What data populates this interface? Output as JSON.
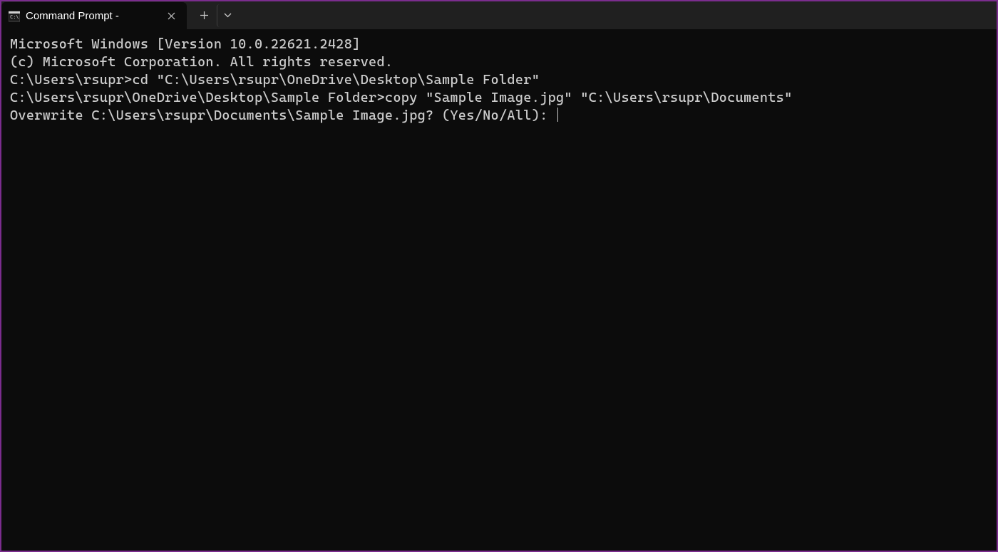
{
  "tab": {
    "title": "Command Prompt -"
  },
  "terminal": {
    "line1": "Microsoft Windows [Version 10.0.22621.2428]",
    "line2": "(c) Microsoft Corporation. All rights reserved.",
    "line3": "",
    "line4": "C:\\Users\\rsupr>cd \"C:\\Users\\rsupr\\OneDrive\\Desktop\\Sample Folder\"",
    "line5": "",
    "line6": "C:\\Users\\rsupr\\OneDrive\\Desktop\\Sample Folder>copy \"Sample Image.jpg\" \"C:\\Users\\rsupr\\Documents\"",
    "line7": "Overwrite C:\\Users\\rsupr\\Documents\\Sample Image.jpg? (Yes/No/All): "
  }
}
